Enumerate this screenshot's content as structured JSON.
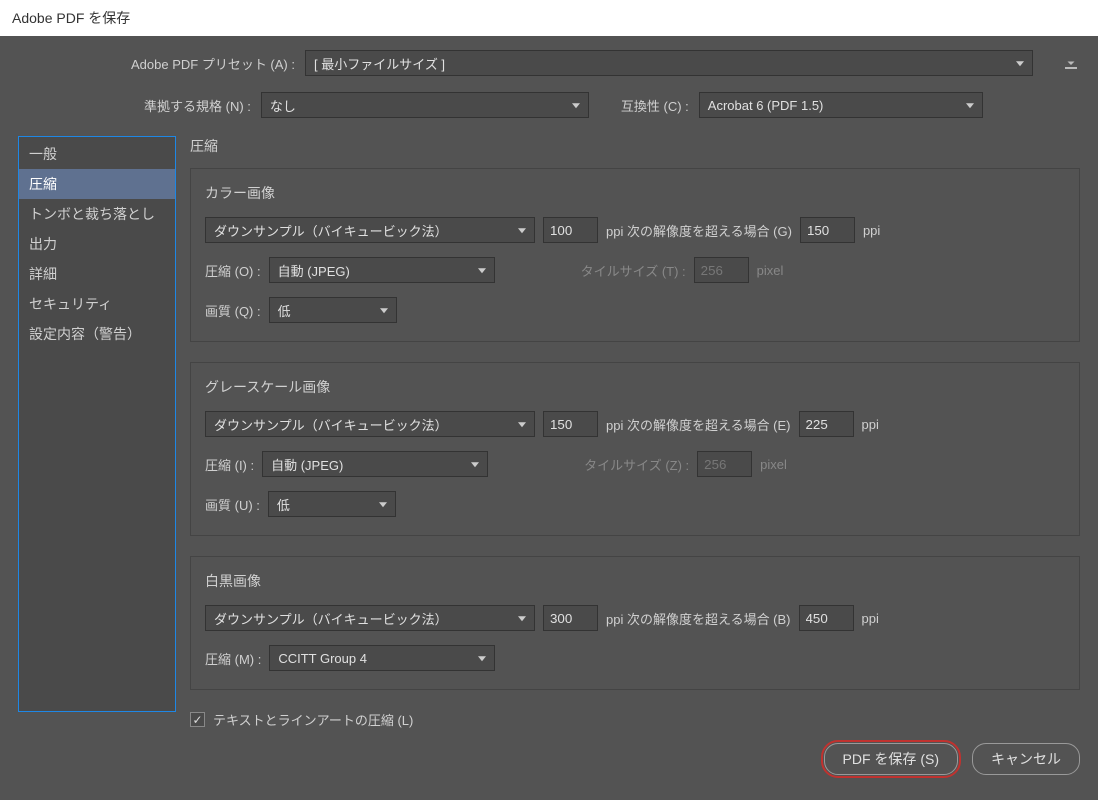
{
  "window": {
    "title": "Adobe PDF を保存"
  },
  "top": {
    "preset_label": "Adobe PDF プリセット (A) :",
    "preset_value": "[ 最小ファイルサイズ ]",
    "standard_label": "準拠する規格 (N) :",
    "standard_value": "なし",
    "compat_label": "互換性 (C) :",
    "compat_value": "Acrobat 6 (PDF 1.5)"
  },
  "sidebar": {
    "items": [
      {
        "label": "一般"
      },
      {
        "label": "圧縮"
      },
      {
        "label": "トンボと裁ち落とし"
      },
      {
        "label": "出力"
      },
      {
        "label": "詳細"
      },
      {
        "label": "セキュリティ"
      },
      {
        "label": "設定内容（警告）"
      }
    ]
  },
  "content": {
    "title": "圧縮",
    "color": {
      "title": "カラー画像",
      "downsample_value": "ダウンサンプル（バイキュービック法）",
      "downsample_ppi": "100",
      "above_label": "ppi 次の解像度を超える場合 (G)",
      "above_ppi": "150",
      "ppi_suffix": "ppi",
      "compress_label": "圧縮 (O) :",
      "compress_value": "自動 (JPEG)",
      "tile_label": "タイルサイズ (T) :",
      "tile_value": "256",
      "tile_unit": "pixel",
      "quality_label": "画質 (Q) :",
      "quality_value": "低"
    },
    "gray": {
      "title": "グレースケール画像",
      "downsample_value": "ダウンサンプル（バイキュービック法）",
      "downsample_ppi": "150",
      "above_label": "ppi 次の解像度を超える場合 (E)",
      "above_ppi": "225",
      "ppi_suffix": "ppi",
      "compress_label": "圧縮 (I) :",
      "compress_value": "自動 (JPEG)",
      "tile_label": "タイルサイズ (Z) :",
      "tile_value": "256",
      "tile_unit": "pixel",
      "quality_label": "画質 (U) :",
      "quality_value": "低"
    },
    "mono": {
      "title": "白黒画像",
      "downsample_value": "ダウンサンプル（バイキュービック法）",
      "downsample_ppi": "300",
      "above_label": "ppi 次の解像度を超える場合 (B)",
      "above_ppi": "450",
      "ppi_suffix": "ppi",
      "compress_label": "圧縮 (M) :",
      "compress_value": "CCITT Group 4"
    },
    "text_compress_label": "テキストとラインアートの圧縮 (L)"
  },
  "footer": {
    "save_label": "PDF を保存 (S)",
    "cancel_label": "キャンセル"
  }
}
